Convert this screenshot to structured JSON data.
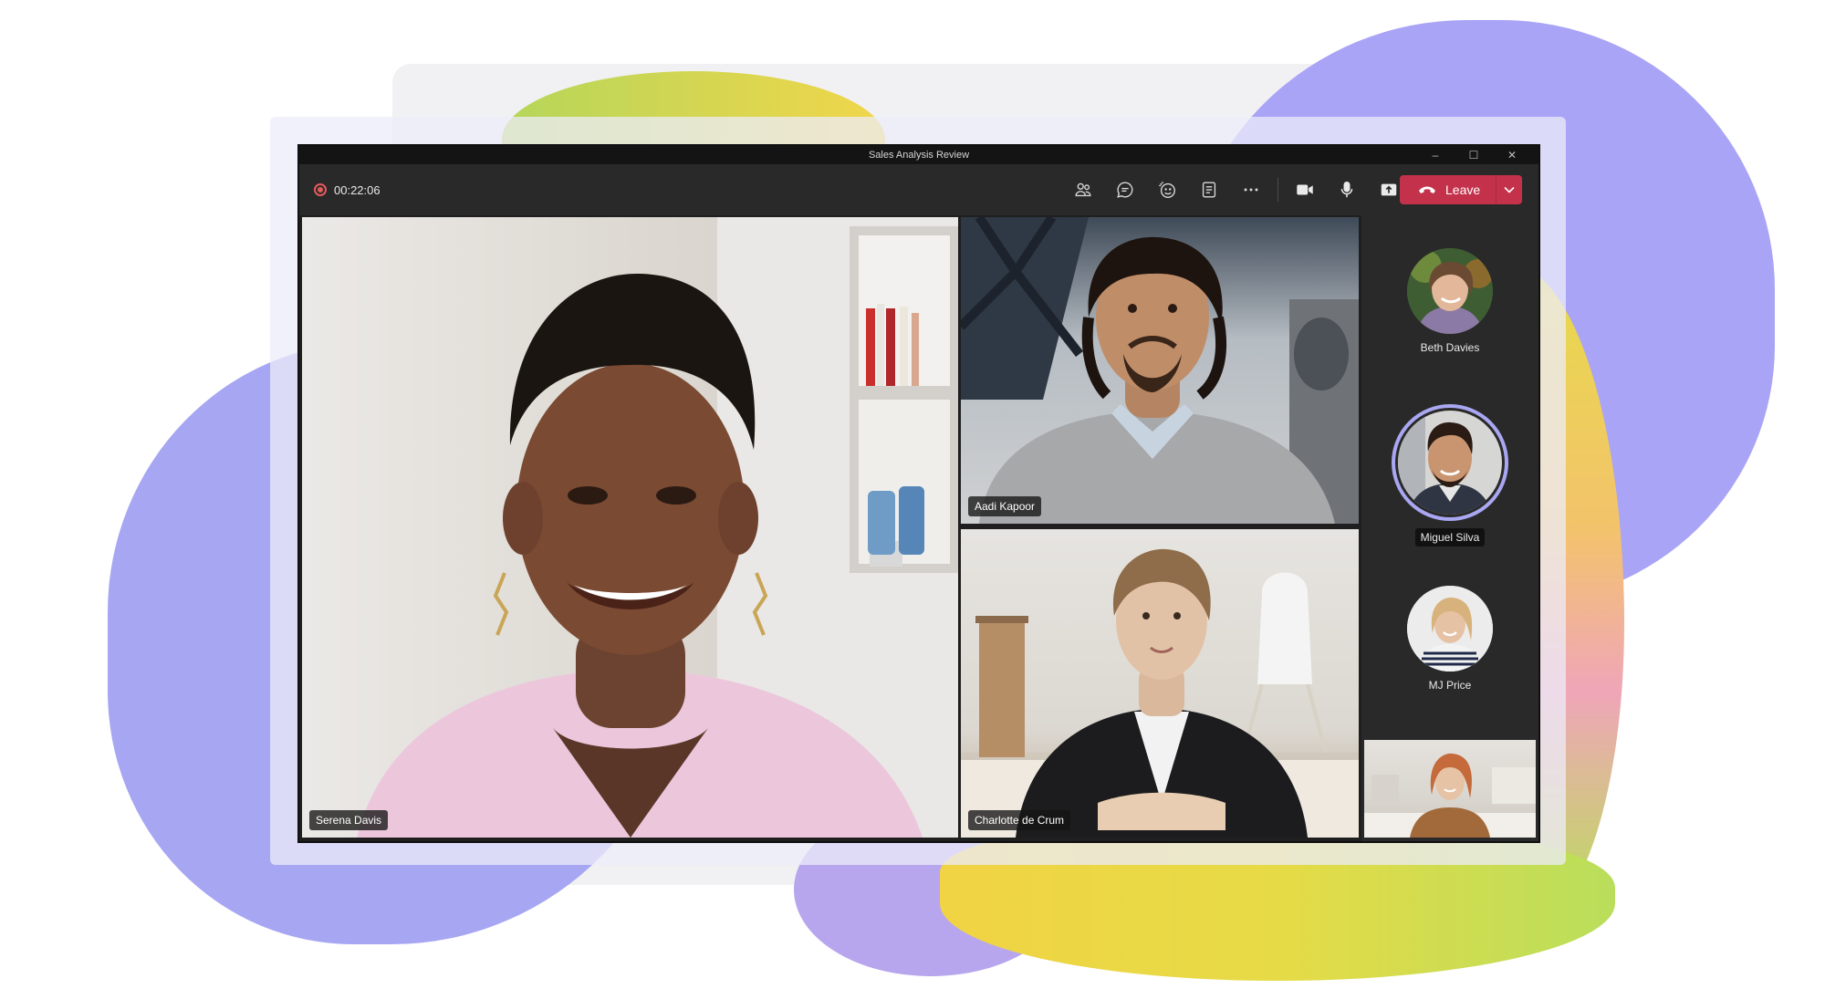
{
  "meeting": {
    "title": "Sales Analysis Review",
    "timer": "00:22:06"
  },
  "window_controls": {
    "minimize": "–",
    "maximize": "☐",
    "close": "✕"
  },
  "toolbar": {
    "icons": [
      "people-icon",
      "chat-icon",
      "reactions-icon",
      "notes-icon",
      "more-icon",
      "camera-icon",
      "mic-icon",
      "share-icon"
    ],
    "leave_label": "Leave"
  },
  "participants": {
    "stage": [
      {
        "name": "Serena Davis"
      },
      {
        "name": "Aadi Kapoor"
      },
      {
        "name": "Charlotte de Crum"
      }
    ],
    "roster": [
      {
        "name": "Beth Davies",
        "active": false
      },
      {
        "name": "Miguel Silva",
        "active": true
      },
      {
        "name": "MJ Price",
        "active": false
      }
    ]
  },
  "colors": {
    "leave_red": "#c4314b",
    "active_ring": "#a9a7f2",
    "record_red": "#e25b5b",
    "toolbar_bg": "#292929"
  }
}
